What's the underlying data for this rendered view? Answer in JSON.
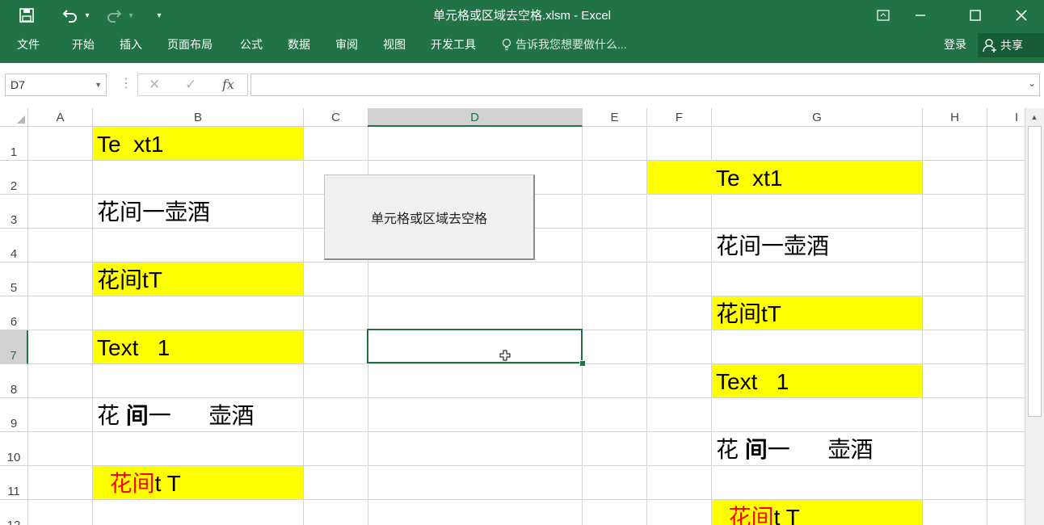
{
  "window": {
    "title": "单元格或区域去空格.xlsm - Excel",
    "qat_undo_dropdown": "▾",
    "qat_redo_dropdown": "▾",
    "qat_customize": "▾"
  },
  "ribbon": {
    "tabs": [
      "文件",
      "开始",
      "插入",
      "页面布局",
      "公式",
      "数据",
      "审阅",
      "视图",
      "开发工具"
    ],
    "tell_me": "告诉我您想要做什么...",
    "login": "登录",
    "share": "共享"
  },
  "formula_bar": {
    "name_box": "D7",
    "cancel": "✕",
    "enter": "✓",
    "fx": "fx",
    "value": ""
  },
  "columns": [
    "A",
    "B",
    "C",
    "D",
    "E",
    "F",
    "G",
    "H",
    "I"
  ],
  "selected_column": "D",
  "rows": [
    "1",
    "2",
    "3",
    "4",
    "5",
    "6",
    "7",
    "8",
    "9",
    "10",
    "11",
    "12"
  ],
  "selected_row": "7",
  "cells": {
    "B1": "Te  xt1",
    "B3": "花间一壶酒",
    "B5": "花间tT",
    "B7": "Text   1",
    "B9_part1": "花 ",
    "B9_bold": "间",
    "B9_part2": "一      壶酒",
    "B11_red": "  花间",
    "B11_rest": "t T",
    "G2": "Te  xt1",
    "G4": "花间一壶酒",
    "G6": "花间tT",
    "G8": "Text   1",
    "G10_part1": "花 ",
    "G10_bold": "间",
    "G10_part2": "一      壶酒",
    "G12_red": "  花间",
    "G12_rest": "t T"
  },
  "macro_button": {
    "label": "单元格或区域去空格"
  },
  "colors": {
    "excel_green": "#217346",
    "highlight_yellow": "#ffff00",
    "red_text": "#ff0000"
  }
}
